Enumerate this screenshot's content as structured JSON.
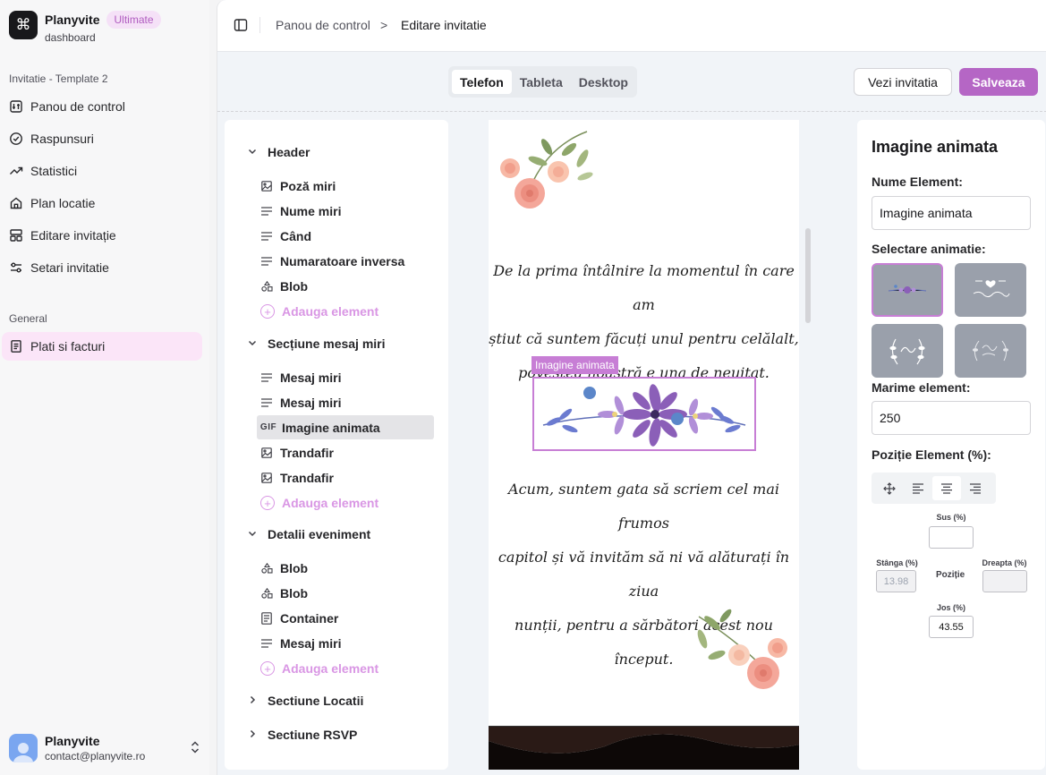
{
  "brand": {
    "name": "Planyvite",
    "badge": "Ultimate",
    "subtitle": "dashboard"
  },
  "sidebar": {
    "group1_label": "Invitatie - Template 2",
    "items": [
      {
        "label": "Panou de control",
        "icon": "sliders-icon"
      },
      {
        "label": "Raspunsuri",
        "icon": "check-circle-icon"
      },
      {
        "label": "Statistici",
        "icon": "trending-up-icon"
      },
      {
        "label": "Plan locatie",
        "icon": "home-icon"
      },
      {
        "label": "Editare invitație",
        "icon": "layout-icon"
      },
      {
        "label": "Setari invitatie",
        "icon": "settings-sliders-icon"
      }
    ],
    "group2_label": "General",
    "general_items": [
      {
        "label": "Plati si facturi",
        "icon": "receipt-icon",
        "active": true
      }
    ]
  },
  "user": {
    "name": "Planyvite",
    "email": "contact@planyvite.ro"
  },
  "breadcrumb": {
    "first": "Panou de control",
    "separator": ">",
    "current": "Editare invitatie"
  },
  "toolbar": {
    "device_tabs": [
      "Telefon",
      "Tableta",
      "Desktop"
    ],
    "active_tab": "Telefon",
    "view_label": "Vezi invitatia",
    "save_label": "Salveaza"
  },
  "tree": {
    "sections": [
      {
        "label": "Header",
        "expanded": true,
        "items": [
          {
            "label": "Poză miri",
            "icon": "image-icon"
          },
          {
            "label": "Nume miri",
            "icon": "text-icon"
          },
          {
            "label": "Când",
            "icon": "text-icon"
          },
          {
            "label": "Numaratoare inversa",
            "icon": "text-icon"
          },
          {
            "label": "Blob",
            "icon": "shapes-icon"
          }
        ]
      },
      {
        "label": "Secțiune mesaj miri",
        "expanded": true,
        "items": [
          {
            "label": "Mesaj miri",
            "icon": "text-icon"
          },
          {
            "label": "Mesaj miri",
            "icon": "text-icon"
          },
          {
            "label": "Imagine animata",
            "icon": "gif-icon",
            "icon_text": "GIF",
            "selected": true
          },
          {
            "label": "Trandafir",
            "icon": "image-icon"
          },
          {
            "label": "Trandafir",
            "icon": "image-icon"
          }
        ]
      },
      {
        "label": "Detalii eveniment",
        "expanded": true,
        "items": [
          {
            "label": "Blob",
            "icon": "shapes-icon"
          },
          {
            "label": "Blob",
            "icon": "shapes-icon"
          },
          {
            "label": "Container",
            "icon": "container-icon"
          },
          {
            "label": "Mesaj miri",
            "icon": "text-icon"
          }
        ]
      },
      {
        "label": "Sectiune Locatii",
        "expanded": false
      },
      {
        "label": "Sectiune RSVP",
        "expanded": false
      }
    ],
    "add_label": "Adauga element"
  },
  "preview": {
    "text_top": [
      "De la prima întâlnire la momentul în care am",
      "știut că suntem făcuți unul pentru celălalt,",
      "povestea noastră e una de neuitat."
    ],
    "selected_label": "Imagine animata",
    "text_bottom": [
      "Acum, suntem gata să scriem cel mai frumos",
      "capitol și vă invităm să ni vă alăturați în ziua",
      "nunții, pentru a sărbători acest nou început."
    ]
  },
  "props": {
    "title": "Imagine animata",
    "name_label": "Nume Element:",
    "name_value": "Imagine animata",
    "animation_label": "Selectare animatie:",
    "size_label": "Marime element:",
    "size_value": "250",
    "position_label": "Poziție Element (%):",
    "top_label": "Sus (%)",
    "top_value": "",
    "left_label": "Stânga (%)",
    "left_value": "13.98",
    "center_label": "Poziție",
    "right_label": "Dreapta (%)",
    "right_value": "",
    "bottom_label": "Jos (%)",
    "bottom_value": "43.55"
  },
  "colors": {
    "accent": "#b566c5",
    "selection": "#c77ed5",
    "active_nav": "#fbe5f8"
  }
}
